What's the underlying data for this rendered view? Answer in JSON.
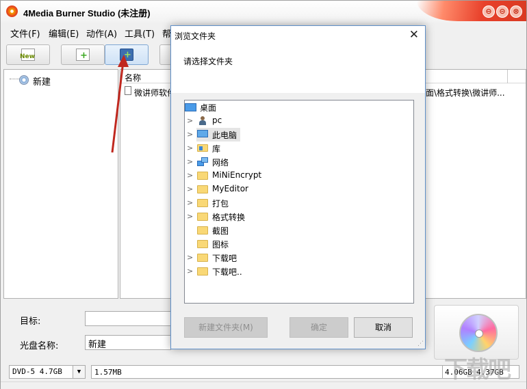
{
  "app": {
    "title": "4Media Burner Studio (未注册)",
    "window_buttons": [
      "⊖",
      "⊝",
      "⊗"
    ],
    "menu": [
      "文件(F)",
      "编辑(E)",
      "动作(A)",
      "工具(T)",
      "帮"
    ],
    "toolbar": {
      "new_label": "New"
    },
    "tree": {
      "root_label": "新建"
    },
    "file_list": {
      "column_name": "名称",
      "rows": [
        {
          "name": "微讲师软件",
          "path": "面\\格式转换\\微讲师..."
        }
      ]
    },
    "target_label": "目标:",
    "disc_name_label": "光盘名称:",
    "disc_name_value": "新建",
    "status": {
      "disc_type": "DVD-5 4.7GB",
      "used": "1.57MB",
      "mark1": "4.06GB",
      "mark2": "4.37GB"
    },
    "watermark": "下载吧"
  },
  "dialog": {
    "title": "浏览文件夹",
    "prompt": "请选择文件夹",
    "items": [
      {
        "label": "桌面",
        "icon": "desktop-icon",
        "expandable": false
      },
      {
        "label": "pc",
        "icon": "user-icon",
        "expandable": true
      },
      {
        "label": "此电脑",
        "icon": "computer-icon",
        "expandable": true,
        "selected": true
      },
      {
        "label": "库",
        "icon": "library-icon",
        "expandable": true
      },
      {
        "label": "网络",
        "icon": "network-icon",
        "expandable": true
      },
      {
        "label": "MiNiEncrypt",
        "icon": "folder-icon",
        "expandable": true
      },
      {
        "label": "MyEditor",
        "icon": "folder-icon",
        "expandable": true
      },
      {
        "label": "打包",
        "icon": "folder-icon",
        "expandable": true
      },
      {
        "label": "格式转换",
        "icon": "folder-icon",
        "expandable": true
      },
      {
        "label": "截图",
        "icon": "folder-icon",
        "expandable": false
      },
      {
        "label": "图标",
        "icon": "folder-icon",
        "expandable": false
      },
      {
        "label": "下载吧",
        "icon": "folder-icon",
        "expandable": true
      },
      {
        "label": "下载吧..",
        "icon": "folder-icon",
        "expandable": true
      }
    ],
    "buttons": {
      "new_folder": "新建文件夹(M)",
      "ok": "确定",
      "cancel": "取消"
    },
    "close_glyph": "✕"
  },
  "colors": {
    "accent_red": "#d93a22",
    "dialog_border": "#5f8fc8",
    "annotation": "#c0281f"
  }
}
